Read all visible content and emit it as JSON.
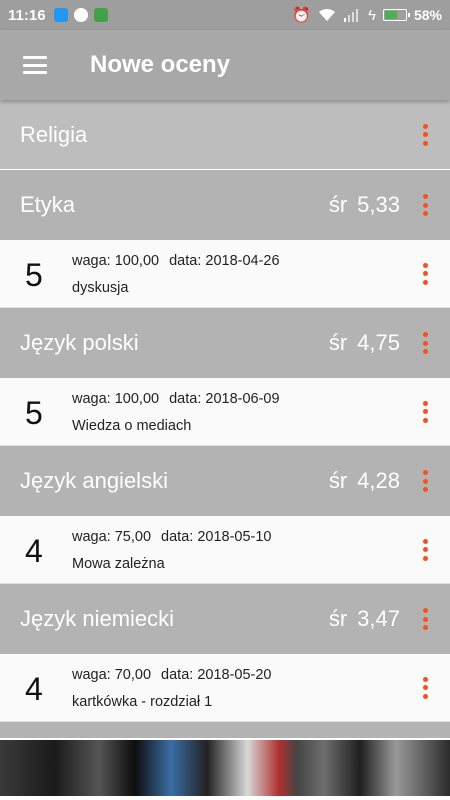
{
  "status_bar": {
    "time": "11:16",
    "battery_percent": "58%",
    "battery_level": 0.58,
    "notification_icons": [
      "vpn-icon",
      "sync-icon",
      "android-icon"
    ]
  },
  "app_bar": {
    "title": "Nowe oceny"
  },
  "subjects": [
    {
      "name": "Religia"
    },
    {
      "name": "Etyka",
      "avg_label": "śr",
      "avg": "5,33",
      "grade": {
        "value": "5",
        "waga_label": "waga:",
        "waga": "100,00",
        "data_label": "data:",
        "date": "2018-04-26",
        "description": "dyskusja"
      }
    },
    {
      "name": "Język polski",
      "avg_label": "śr",
      "avg": "4,75",
      "grade": {
        "value": "5",
        "waga_label": "waga:",
        "waga": "100,00",
        "data_label": "data:",
        "date": "2018-06-09",
        "description": "Wiedza o mediach"
      }
    },
    {
      "name": "Język angielski",
      "avg_label": "śr",
      "avg": "4,28",
      "grade": {
        "value": "4",
        "waga_label": "waga:",
        "waga": "75,00",
        "data_label": "data:",
        "date": "2018-05-10",
        "description": "Mowa zależna"
      }
    },
    {
      "name": "Język niemiecki",
      "avg_label": "śr",
      "avg": "3,47",
      "grade": {
        "value": "4",
        "waga_label": "waga:",
        "waga": "70,00",
        "data_label": "data:",
        "date": "2018-05-20",
        "description": "kartkówka - rozdział 1"
      }
    }
  ],
  "colors": {
    "accent": "#f4511e",
    "app_bar": "#a8a8a8",
    "subject_header": "#b3b3b3"
  }
}
